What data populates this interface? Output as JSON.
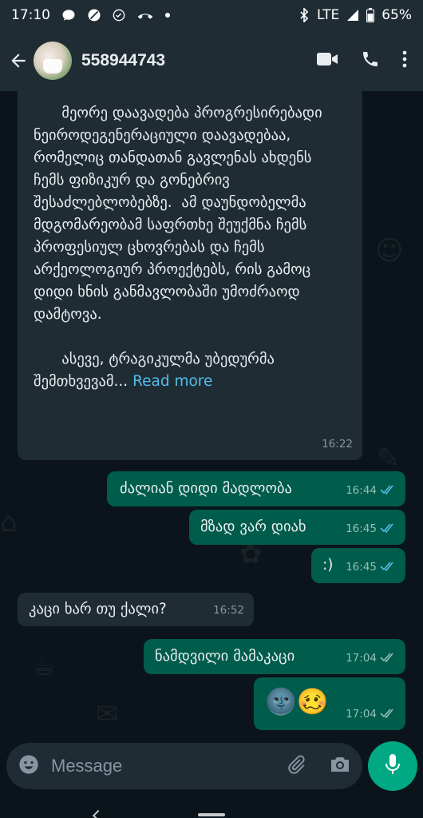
{
  "status_bar": {
    "time": "17:10",
    "network": "LTE",
    "battery": "65%"
  },
  "header": {
    "contact_name": "558944743",
    "icons": [
      "back-arrow-icon",
      "video-call-icon",
      "phone-icon",
      "more-vert-icon"
    ]
  },
  "messages": [
    {
      "direction": "incoming",
      "text": "      მეორე დაავადება პროგრესირებადი ნეიროდეგენერაციული დაავადებაა, რომელიც თანდათან გავლენას ახდენს ჩემს ფიზიკურ და გონებრივ შესაძლებლობებზე.  ამ დაუნდობელმა მდგომარეობამ საფრთხე შეუქმნა ჩემს პროფესიულ ცხოვრებას და ჩემს არქეოლოგიურ პროექტებს, რის გამოც დიდი ხნის განმავლობაში უმოძრაოდ დამტოვა.\n\n      ასევე, ტრაგიკულმა უბედურმა შემთხვევამ...",
      "read_more": "Read more",
      "time": "16:22"
    },
    {
      "direction": "outgoing",
      "text": "ძალიან დიდი მადლობა",
      "time": "16:44",
      "status": "read"
    },
    {
      "direction": "outgoing",
      "text": "მზად ვარ დიახ",
      "time": "16:45",
      "status": "read"
    },
    {
      "direction": "outgoing",
      "text": ":)",
      "time": "16:45",
      "status": "read"
    },
    {
      "direction": "incoming",
      "text": "კაცი ხარ თუ ქალი?",
      "time": "16:52"
    },
    {
      "direction": "outgoing",
      "text": "ნამდვილი მამაკაცი",
      "time": "17:04",
      "status": "delivered"
    },
    {
      "direction": "outgoing",
      "text": "🌚🥴",
      "time": "17:04",
      "status": "delivered"
    }
  ],
  "input": {
    "placeholder": "Message"
  },
  "colors": {
    "background": "#0b141a",
    "header": "#1f2c34",
    "incoming_bubble": "#1f2c34",
    "outgoing_bubble": "#005c4b",
    "accent": "#00a884",
    "link": "#53bdeb",
    "read_ticks": "#53bdeb"
  }
}
